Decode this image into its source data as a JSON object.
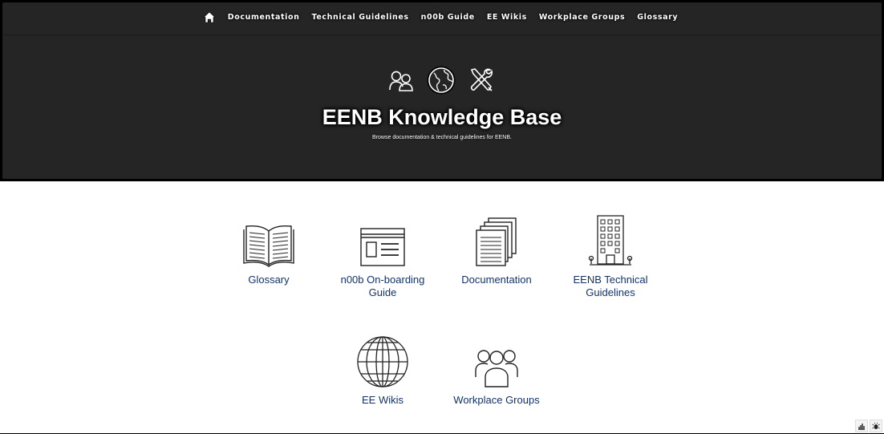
{
  "nav": {
    "home_icon": "home-icon",
    "items": [
      "Documentation",
      "Technical Guidelines",
      "n00b Guide",
      "EE Wikis",
      "Workplace Groups",
      "Glossary"
    ]
  },
  "hero": {
    "icons": [
      "people-icon",
      "globe-icon",
      "tools-icon"
    ],
    "title": "EENB Knowledge Base",
    "subtitle": "Browse documentation & technical guidelines for EENB."
  },
  "tiles": [
    {
      "label": "Glossary",
      "icon": "open-book-icon"
    },
    {
      "label": "n00b On-boarding Guide",
      "icon": "browser-window-icon"
    },
    {
      "label": "Documentation",
      "icon": "document-stack-icon"
    },
    {
      "label": "EENB Technical Guidelines",
      "icon": "building-icon"
    },
    {
      "label": "EE Wikis",
      "icon": "globe-icon"
    },
    {
      "label": "Workplace Groups",
      "icon": "group-icon"
    }
  ],
  "colors": {
    "header_bg": "#252525",
    "link": "#13326b"
  }
}
